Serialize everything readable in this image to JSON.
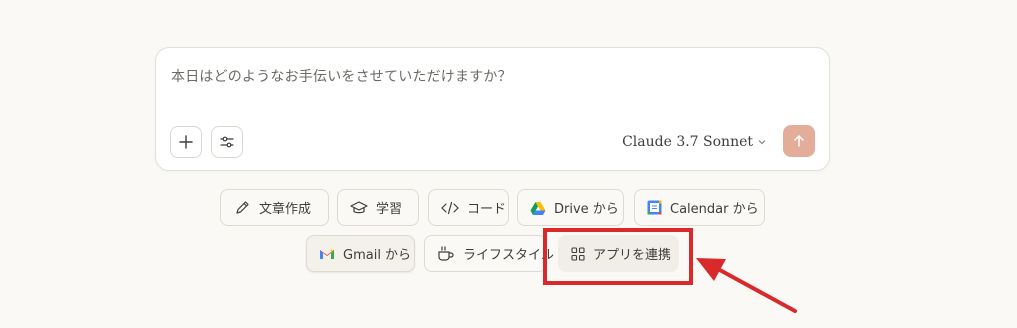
{
  "composer": {
    "placeholder": "本日はどのようなお手伝いをさせていただけますか？",
    "model_name": "Claude 3.7 Sonnet",
    "icons": [
      "plus-icon",
      "sliders-icon",
      "chevron-down-icon",
      "arrow-up-icon"
    ]
  },
  "chips": [
    {
      "label": "文章作成",
      "icon": "pencil-icon"
    },
    {
      "label": "学習",
      "icon": "graduation-cap-icon"
    },
    {
      "label": "コード",
      "icon": "code-icon"
    },
    {
      "label": "Drive から",
      "icon": "google-drive-icon"
    },
    {
      "label": "Calendar から",
      "icon": "google-calendar-icon"
    },
    {
      "label": "Gmail から",
      "icon": "gmail-icon"
    },
    {
      "label": "ライフスタイル",
      "icon": "coffee-cup-icon"
    },
    {
      "label": "アプリを連携",
      "icon": "grid-icon"
    }
  ],
  "colors": {
    "background": "#faf9f5",
    "send_button": "#e4ad9a",
    "annotation": "#d82a2a"
  }
}
